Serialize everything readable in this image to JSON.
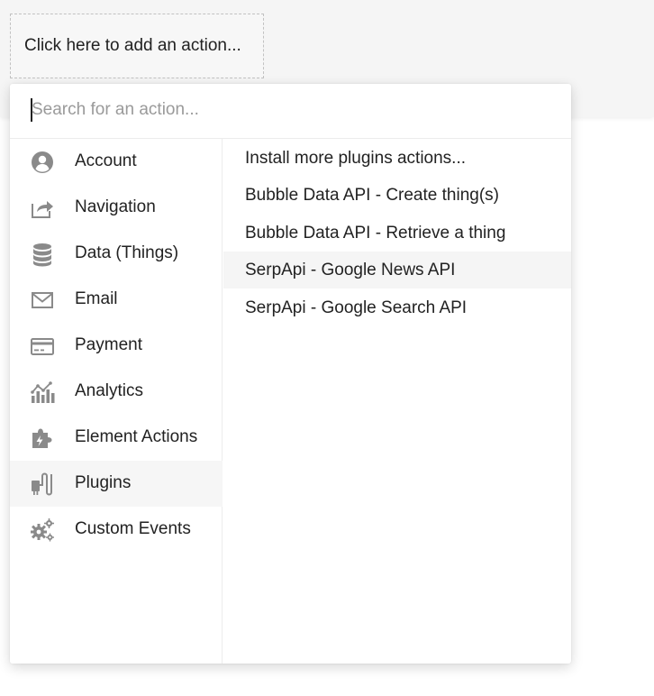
{
  "trigger": {
    "label": "Click here to add an action..."
  },
  "search": {
    "placeholder": "Search for an action...",
    "value": ""
  },
  "categories": [
    {
      "label": "Account",
      "icon": "account-icon"
    },
    {
      "label": "Navigation",
      "icon": "navigation-icon"
    },
    {
      "label": "Data (Things)",
      "icon": "database-icon"
    },
    {
      "label": "Email",
      "icon": "email-icon"
    },
    {
      "label": "Payment",
      "icon": "credit-card-icon"
    },
    {
      "label": "Analytics",
      "icon": "analytics-icon"
    },
    {
      "label": "Element Actions",
      "icon": "puzzle-lightning-icon"
    },
    {
      "label": "Plugins",
      "icon": "plugins-icon"
    },
    {
      "label": "Custom Events",
      "icon": "gears-icon"
    }
  ],
  "selected_category": "Plugins",
  "actions": [
    {
      "label": "Install more plugins actions..."
    },
    {
      "label": "Bubble Data API - Create thing(s)"
    },
    {
      "label": "Bubble Data API - Retrieve a thing"
    },
    {
      "label": "SerpApi - Google News API"
    },
    {
      "label": "SerpApi - Google Search API"
    }
  ],
  "hovered_action": "SerpApi - Google News API",
  "colors": {
    "icon_gray": "#8a8a8a",
    "text": "#222222",
    "placeholder": "#9a9a9a",
    "highlight": "#f5f5f5"
  }
}
